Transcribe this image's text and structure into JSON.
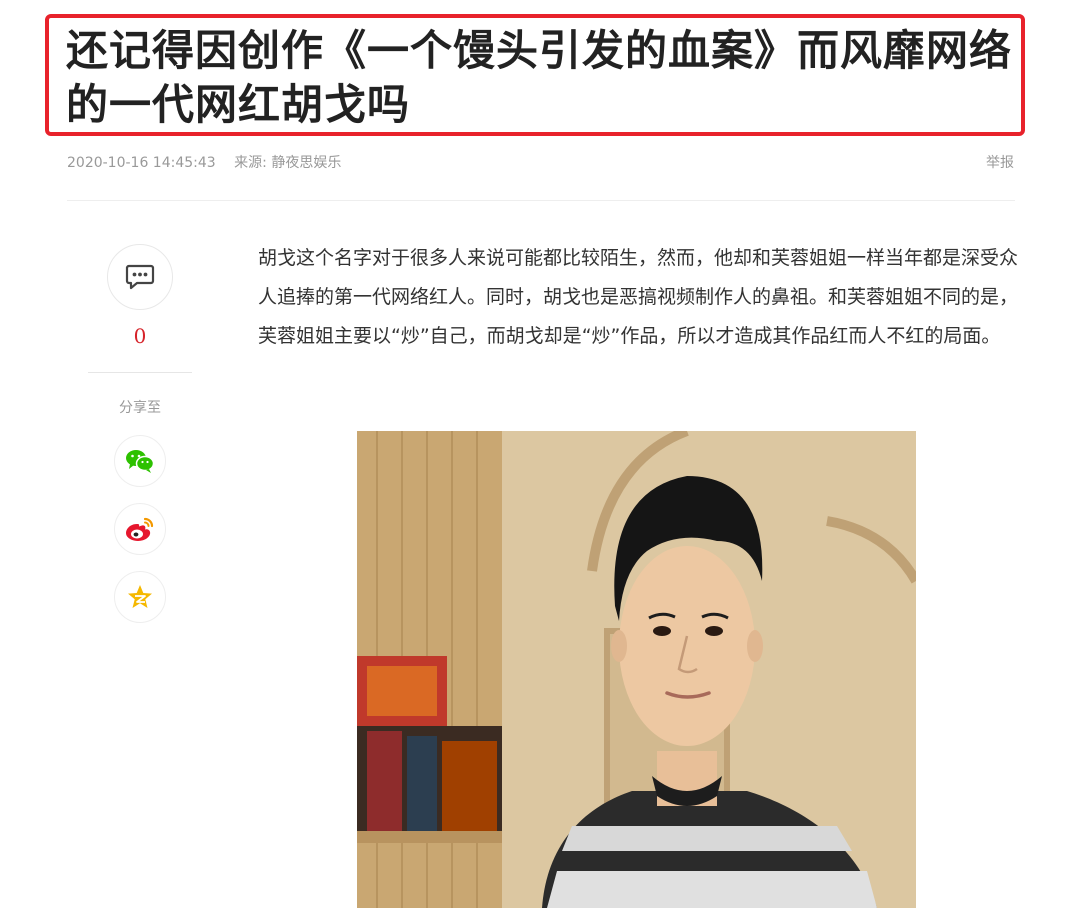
{
  "article": {
    "title": "还记得因创作《一个馒头引发的血案》而风靡网络的一代网红胡戈吗",
    "date": "2020-10-16 14:45:43",
    "source": "来源: 静夜思娱乐",
    "report_label": "举报",
    "paragraph": "胡戈这个名字对于很多人来说可能都比较陌生，然而，他却和芙蓉姐姐一样当年都是深受众人追捧的第一代网络红人。同时，胡戈也是恶搞视频制作人的鼻祖。和芙蓉姐姐不同的是，芙蓉姐姐主要以“炒”自己，而胡戈却是“炒”作品，所以才造成其作品红而人不红的局面。"
  },
  "sidebar": {
    "comment_count": "0",
    "share_label": "分享至",
    "share_icons": [
      "wechat-icon",
      "weibo-icon",
      "qzone-icon"
    ]
  },
  "colors": {
    "accent": "#e8222b",
    "meta": "#999999",
    "text": "#333333",
    "wechat": "#2dc100",
    "weibo": "#e6162d",
    "qzone": "#f5b800"
  }
}
